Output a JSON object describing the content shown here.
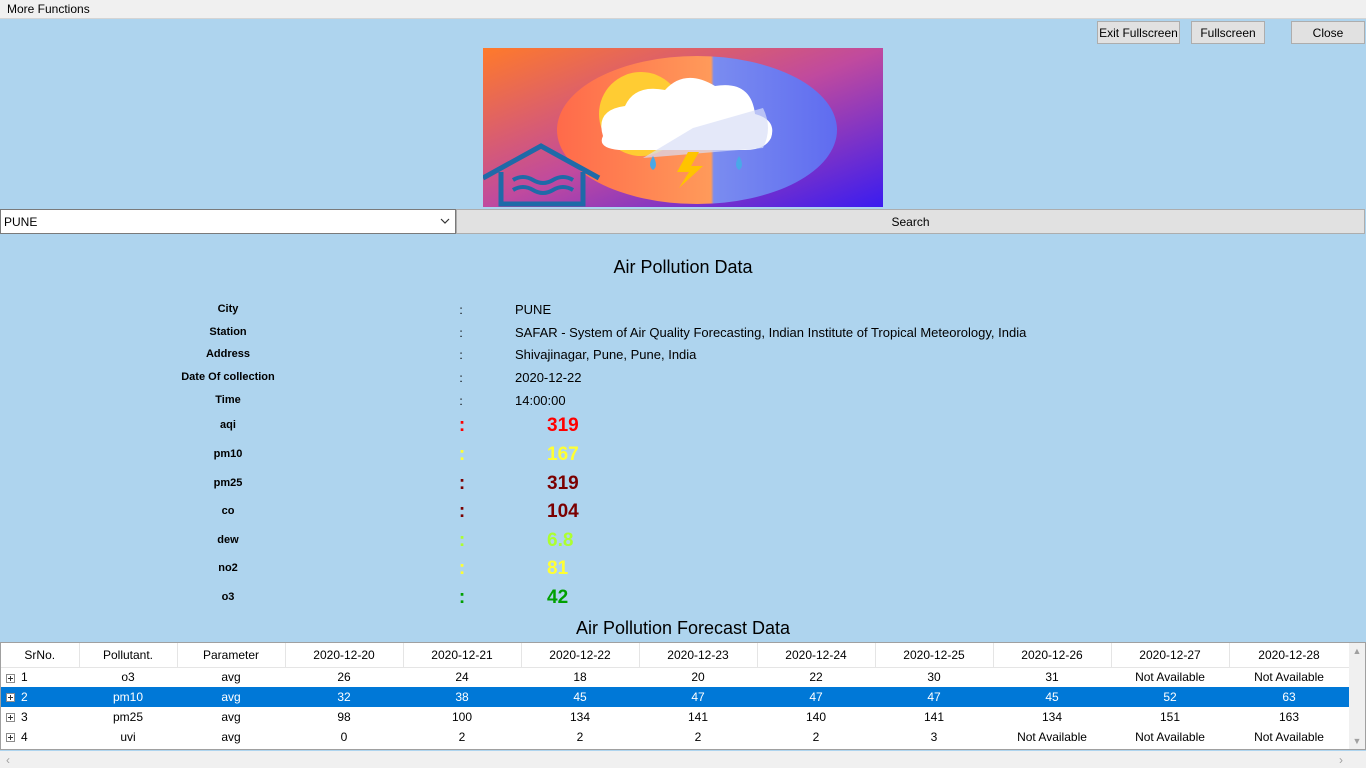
{
  "menu": {
    "more_functions": "More Functions"
  },
  "window_buttons": {
    "exit_fullscreen": "Exit Fullscreen",
    "fullscreen": "Fullscreen",
    "close": "Close"
  },
  "search": {
    "city": "PUNE",
    "button": "Search"
  },
  "title": "Air Pollution Data",
  "info": [
    {
      "label": "City",
      "value": "PUNE"
    },
    {
      "label": "Station",
      "value": "SAFAR - System of Air Quality Forecasting, Indian Institute of Tropical Meteorology, India"
    },
    {
      "label": "Address",
      "value": "Shivajinagar, Pune, Pune, India"
    },
    {
      "label": "Date Of collection",
      "value": "2020-12-22"
    },
    {
      "label": "Time",
      "value": "14:00:00"
    }
  ],
  "colon": ":",
  "pollutants": [
    {
      "label": "aqi",
      "value": "319",
      "color": "#ff0000"
    },
    {
      "label": "pm10",
      "value": "167",
      "color": "#ffff33"
    },
    {
      "label": "pm25",
      "value": "319",
      "color": "#7b0000"
    },
    {
      "label": "co",
      "value": "104",
      "color": "#7b0000"
    },
    {
      "label": "dew",
      "value": "6.8",
      "color": "#adff2f"
    },
    {
      "label": "no2",
      "value": "81",
      "color": "#ffff33"
    },
    {
      "label": "o3",
      "value": "42",
      "color": "#00a000"
    }
  ],
  "forecast_title": "Air Pollution Forecast Data",
  "forecast": {
    "columns": [
      "SrNo.",
      "Pollutant.",
      "Parameter",
      "2020-12-20",
      "2020-12-21",
      "2020-12-22",
      "2020-12-23",
      "2020-12-24",
      "2020-12-25",
      "2020-12-26",
      "2020-12-27",
      "2020-12-28"
    ],
    "rows": [
      [
        "1",
        "o3",
        "avg",
        "26",
        "24",
        "18",
        "20",
        "22",
        "30",
        "31",
        "Not Available",
        "Not Available"
      ],
      [
        "2",
        "pm10",
        "avg",
        "32",
        "38",
        "45",
        "47",
        "47",
        "47",
        "45",
        "52",
        "63"
      ],
      [
        "3",
        "pm25",
        "avg",
        "98",
        "100",
        "134",
        "141",
        "140",
        "141",
        "134",
        "151",
        "163"
      ],
      [
        "4",
        "uvi",
        "avg",
        "0",
        "2",
        "2",
        "2",
        "2",
        "3",
        "Not Available",
        "Not Available",
        "Not Available"
      ]
    ],
    "selected_row": 1
  }
}
